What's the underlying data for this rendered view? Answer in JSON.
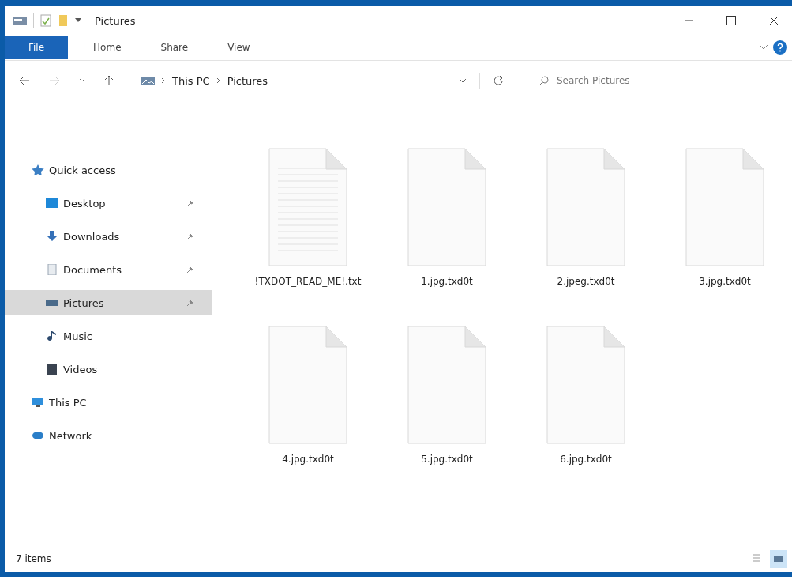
{
  "window": {
    "title": "Pictures"
  },
  "ribbon_tabs": [
    {
      "label": "File",
      "selected": true
    },
    {
      "label": "Home",
      "selected": false
    },
    {
      "label": "Share",
      "selected": false
    },
    {
      "label": "View",
      "selected": false
    }
  ],
  "address": {
    "path": [
      "This PC",
      "Pictures"
    ]
  },
  "search": {
    "placeholder": "Search Pictures"
  },
  "sidebar": {
    "items": [
      {
        "kind": "quick",
        "label": "Quick access",
        "pinned": false,
        "selected": false,
        "children": [
          {
            "kind": "desktop",
            "label": "Desktop",
            "pinned": true,
            "selected": false
          },
          {
            "kind": "downloads",
            "label": "Downloads",
            "pinned": true,
            "selected": false
          },
          {
            "kind": "documents",
            "label": "Documents",
            "pinned": true,
            "selected": false
          },
          {
            "kind": "pictures",
            "label": "Pictures",
            "pinned": true,
            "selected": true
          },
          {
            "kind": "music",
            "label": "Music",
            "pinned": false,
            "selected": false
          },
          {
            "kind": "videos",
            "label": "Videos",
            "pinned": false,
            "selected": false
          }
        ]
      },
      {
        "kind": "pc",
        "label": "This PC",
        "pinned": false,
        "selected": false
      },
      {
        "kind": "network",
        "label": "Network",
        "pinned": false,
        "selected": false
      }
    ]
  },
  "files": [
    {
      "kind": "text",
      "name": "!TXDOT_READ_ME!.txt"
    },
    {
      "kind": "blank",
      "name": "1.jpg.txd0t"
    },
    {
      "kind": "blank",
      "name": "2.jpeg.txd0t"
    },
    {
      "kind": "blank",
      "name": "3.jpg.txd0t"
    },
    {
      "kind": "blank",
      "name": "4.jpg.txd0t"
    },
    {
      "kind": "blank",
      "name": "5.jpg.txd0t"
    },
    {
      "kind": "blank",
      "name": "6.jpg.txd0t"
    }
  ],
  "status_bar": {
    "count": "7 items"
  }
}
